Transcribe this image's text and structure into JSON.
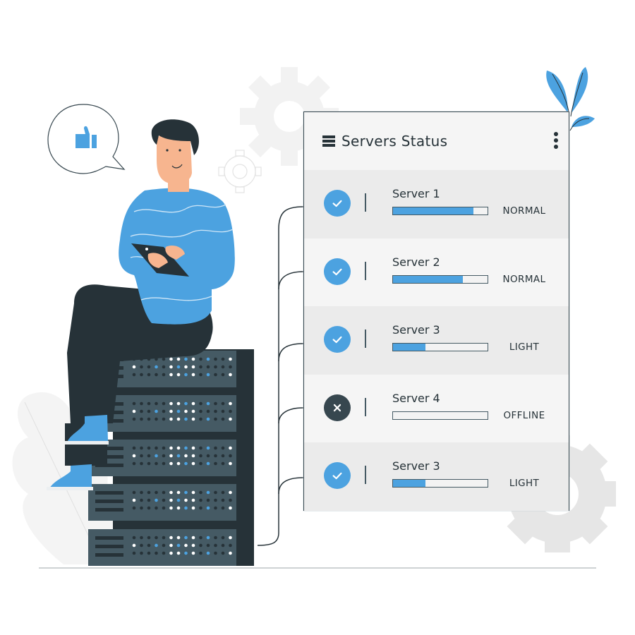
{
  "panel": {
    "title": "Servers Status",
    "header_icon": "server-list-icon",
    "menu_icon": "more-vertical-icon"
  },
  "servers": [
    {
      "name": "Server 1",
      "status": "NORMAL",
      "load_percent": 85,
      "state": "online",
      "icon": "check-circle-icon"
    },
    {
      "name": "Server 2",
      "status": "NORMAL",
      "load_percent": 74,
      "state": "online",
      "icon": "check-circle-icon"
    },
    {
      "name": "Server 3",
      "status": "LIGHT",
      "load_percent": 34,
      "state": "online",
      "icon": "check-circle-icon"
    },
    {
      "name": "Server 4",
      "status": "OFFLINE",
      "load_percent": 0,
      "state": "offline",
      "icon": "x-circle-icon"
    },
    {
      "name": "Server 3",
      "status": "LIGHT",
      "load_percent": 34,
      "state": "online",
      "icon": "check-circle-icon"
    }
  ],
  "colors": {
    "accent": "#4ca2e0",
    "dark": "#263238",
    "rack": "#455a64",
    "panel_bg": "#f5f5f5",
    "row_alt_bg": "#ebebeb",
    "offline": "#37474f"
  },
  "decor": {
    "speech_bubble_icon": "thumbs-up-icon"
  }
}
